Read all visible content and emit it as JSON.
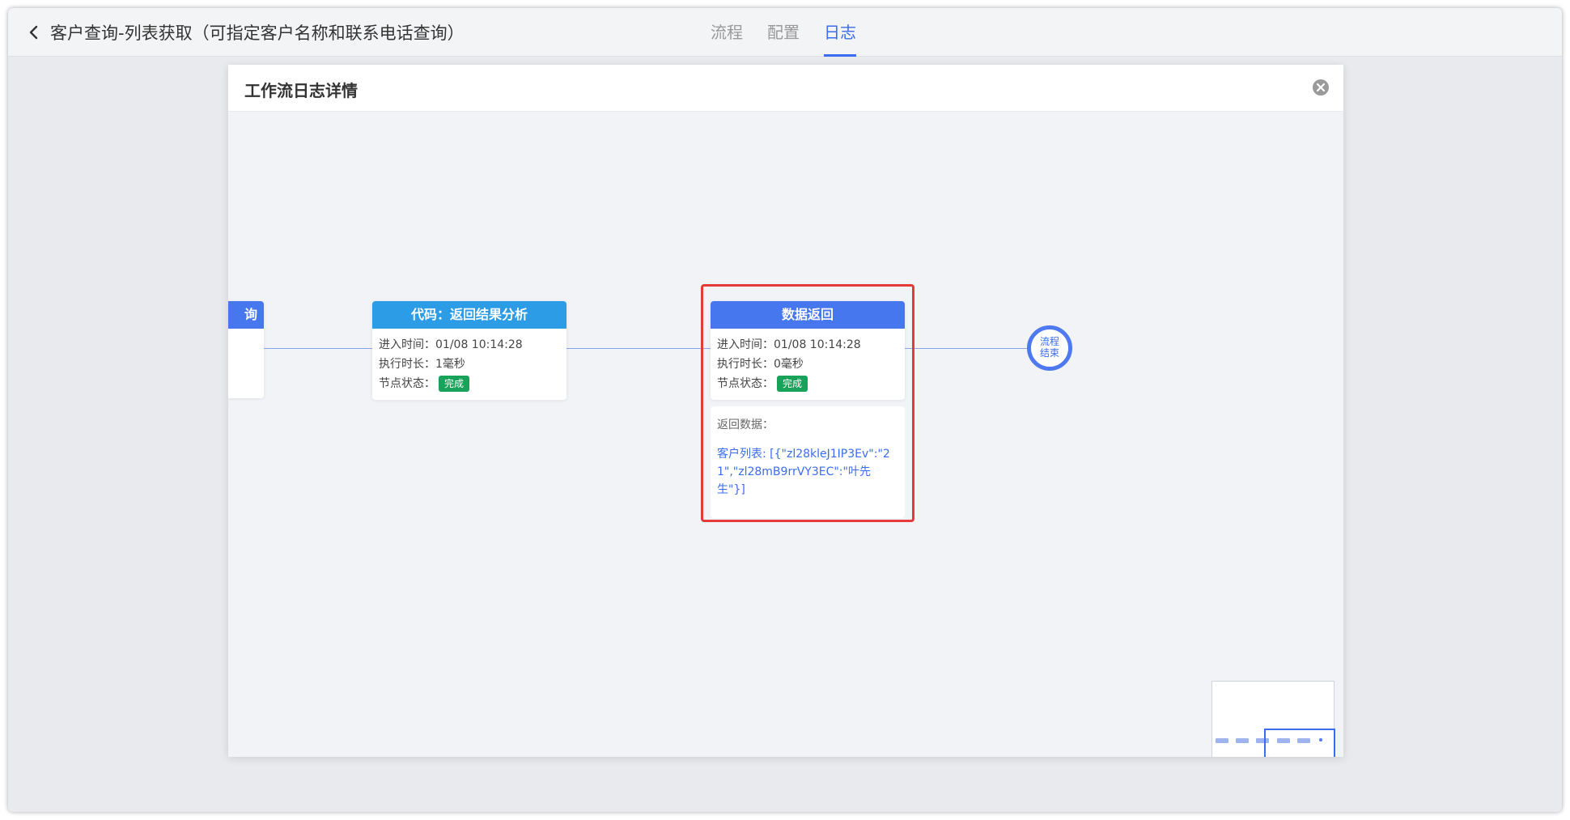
{
  "header": {
    "title": "客户查询-列表获取（可指定客户名称和联系电话查询）",
    "tabs": [
      {
        "label": "流程",
        "active": false
      },
      {
        "label": "配置",
        "active": false
      },
      {
        "label": "日志",
        "active": true
      }
    ]
  },
  "dialog": {
    "title": "工作流日志详情"
  },
  "nodes": {
    "partial": {
      "title": "询"
    },
    "code": {
      "title": "代码：返回结果分析",
      "enter_label": "进入时间：",
      "enter_value": "01/08 10:14:28",
      "duration_label": "执行时长：",
      "duration_value": "1毫秒",
      "status_label": "节点状态：",
      "status_value": "完成"
    },
    "data_return": {
      "title": "数据返回",
      "enter_label": "进入时间：",
      "enter_value": "01/08 10:14:28",
      "duration_label": "执行时长：",
      "duration_value": "0毫秒",
      "status_label": "节点状态：",
      "status_value": "完成",
      "return_label": "返回数据：",
      "return_value": "客户列表: [{\"zl28kleJ1IP3Ev\":\"21\",\"zl28mB9rrVY3EC\":\"叶先生\"}]"
    },
    "end": {
      "label": "流程结束"
    }
  },
  "colors": {
    "accent": "#3b6cf0",
    "node_head_blue": "#4677ee",
    "node_head_cyan": "#2d9ce6",
    "status_green": "#19a35a",
    "highlight_red": "#e53a3a"
  }
}
